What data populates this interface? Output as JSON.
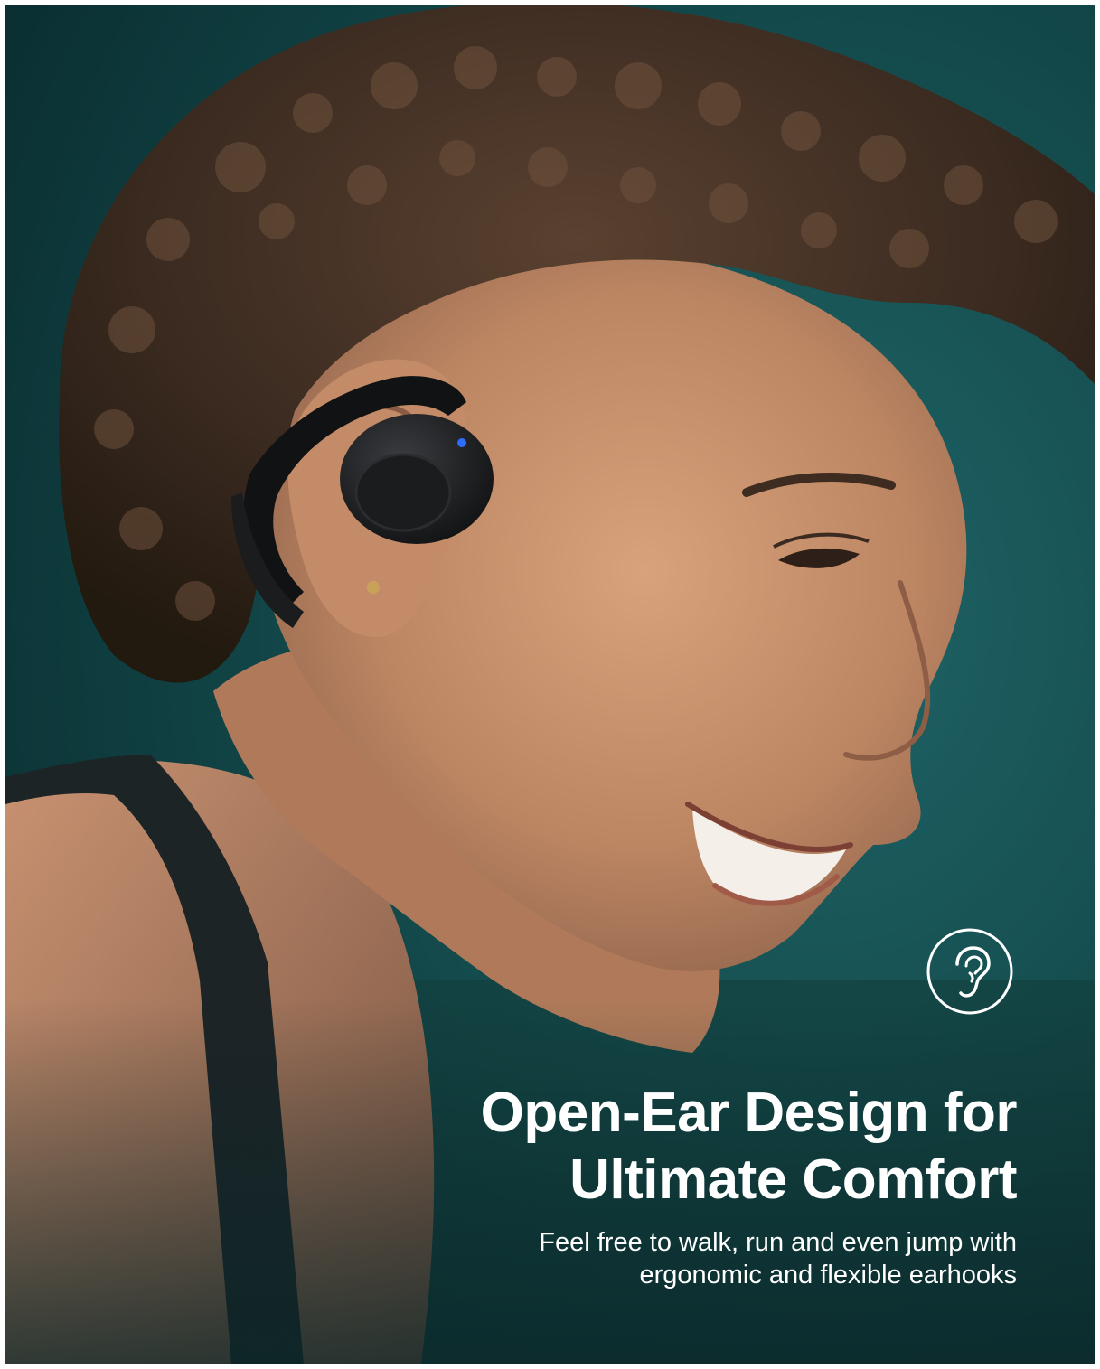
{
  "image": {
    "subject": "woman-wearing-open-ear-earbud",
    "icon": "ear-icon"
  },
  "headline": {
    "line1": "Open-Ear Design for",
    "line2": "Ultimate Comfort"
  },
  "subtext": {
    "line1": "Feel free to walk, run and even jump with",
    "line2": "ergonomic and flexible earhooks"
  },
  "colors": {
    "background": "#0f3d40",
    "text": "#ffffff",
    "earbud": "#141516",
    "led": "#2f6bff"
  }
}
